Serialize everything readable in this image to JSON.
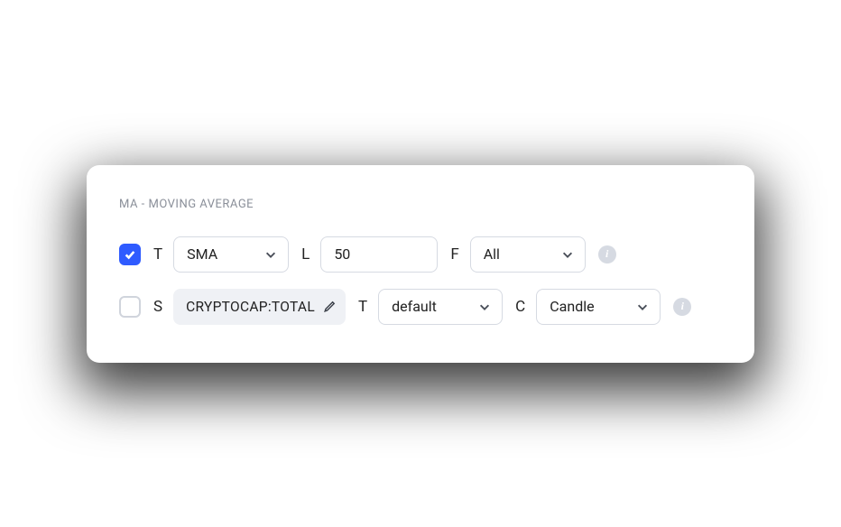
{
  "title": "MA - MOVING AVERAGE",
  "row1": {
    "checked": true,
    "labels": {
      "t": "T",
      "l": "L",
      "f": "F"
    },
    "type": "SMA",
    "length": "50",
    "filter": "All"
  },
  "row2": {
    "checked": false,
    "labels": {
      "s": "S",
      "t": "T",
      "c": "C"
    },
    "symbol": "CRYPTOCAP:TOTAL",
    "time": "default",
    "chart": "Candle"
  },
  "info_char": "i"
}
